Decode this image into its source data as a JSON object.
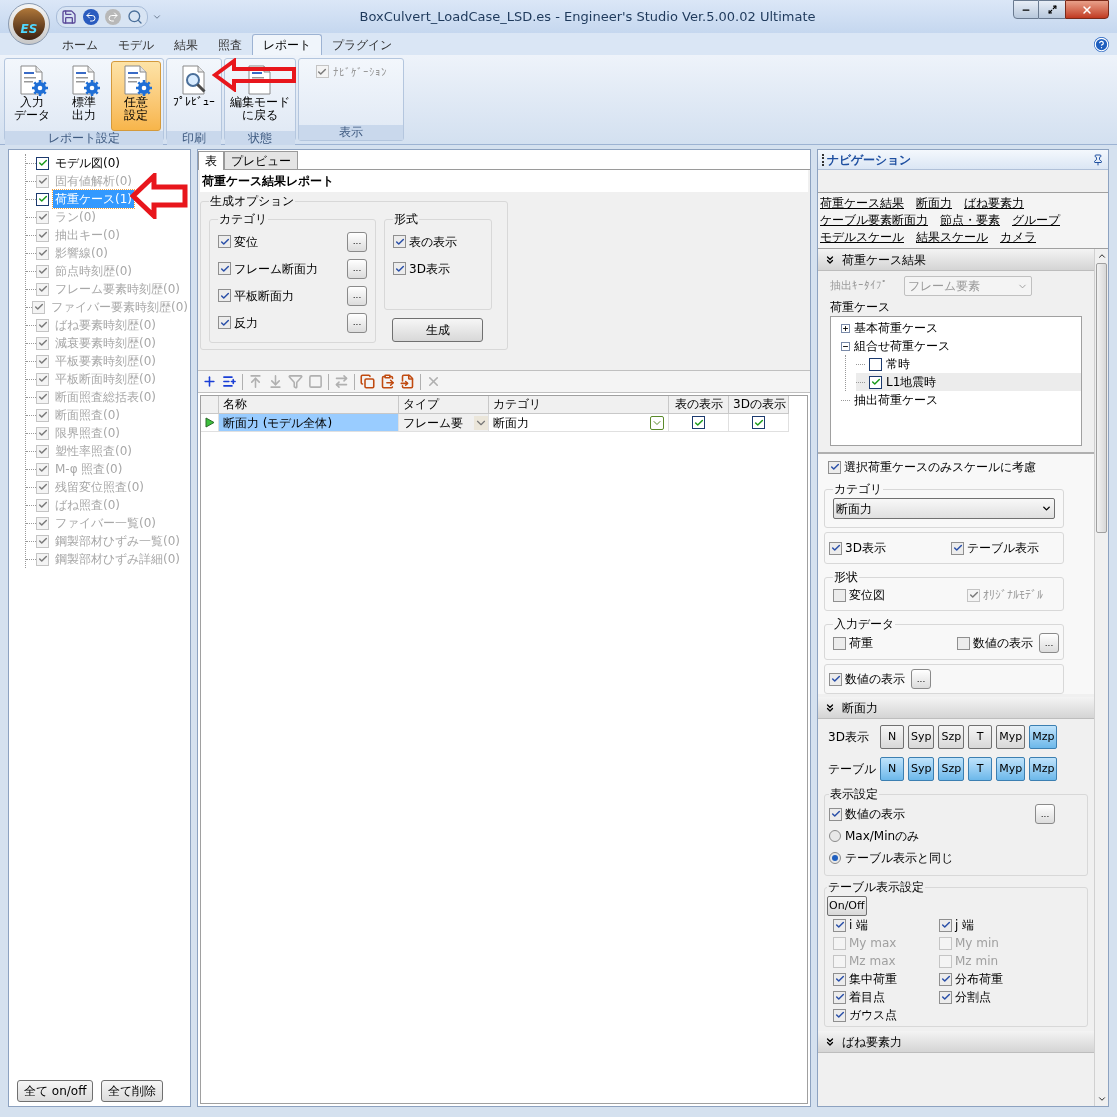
{
  "window": {
    "title": "BoxCulvert_LoadCase_LSD.es - Engineer's Studio Ver.5.00.02 Ultimate",
    "logo": "ES"
  },
  "ribbon_tabs": [
    {
      "label": "ホーム",
      "selected": false
    },
    {
      "label": "モデル",
      "selected": false
    },
    {
      "label": "結果",
      "selected": false
    },
    {
      "label": "照査",
      "selected": false
    },
    {
      "label": "レポート",
      "selected": true
    },
    {
      "label": "プラグイン",
      "selected": false
    }
  ],
  "ribbon_groups": [
    {
      "label": "レポート設定",
      "items": [
        {
          "kind": "button",
          "lines": [
            "入力",
            "データ"
          ],
          "selected": false
        },
        {
          "kind": "button",
          "lines": [
            "標準",
            "出力"
          ],
          "selected": false
        },
        {
          "kind": "button",
          "lines": [
            "任意",
            "設定"
          ],
          "selected": true
        }
      ]
    },
    {
      "label": "印刷",
      "items": [
        {
          "kind": "button",
          "lines": [
            "ﾌﾟﾚﾋﾞｭｰ"
          ],
          "selected": false
        }
      ]
    },
    {
      "label": "状態",
      "items": [
        {
          "kind": "button",
          "lines": [
            "編集モード",
            "に戻る"
          ],
          "selected": false
        }
      ]
    },
    {
      "label": "表示",
      "items": [
        {
          "kind": "checkbox",
          "label": "ﾅﾋﾞｹﾞｰｼｮﾝ",
          "checked": true,
          "disabled": true
        }
      ]
    }
  ],
  "tree": {
    "items": [
      {
        "label": "モデル図(0)",
        "checked": true,
        "disabled": false,
        "selected": false
      },
      {
        "label": "固有値解析(0)",
        "checked": true,
        "disabled": true,
        "selected": false
      },
      {
        "label": "荷重ケース(1)",
        "checked": true,
        "disabled": false,
        "selected": true
      },
      {
        "label": "ラン(0)",
        "checked": true,
        "disabled": true,
        "selected": false
      },
      {
        "label": "抽出キー(0)",
        "checked": true,
        "disabled": true,
        "selected": false
      },
      {
        "label": "影響線(0)",
        "checked": true,
        "disabled": true,
        "selected": false
      },
      {
        "label": "節点時刻歴(0)",
        "checked": true,
        "disabled": true,
        "selected": false
      },
      {
        "label": "フレーム要素時刻歴(0)",
        "checked": true,
        "disabled": true,
        "selected": false
      },
      {
        "label": "ファイバー要素時刻歴(0)",
        "checked": true,
        "disabled": true,
        "selected": false
      },
      {
        "label": "ばね要素時刻歴(0)",
        "checked": true,
        "disabled": true,
        "selected": false
      },
      {
        "label": "減衰要素時刻歴(0)",
        "checked": true,
        "disabled": true,
        "selected": false
      },
      {
        "label": "平板要素時刻歴(0)",
        "checked": true,
        "disabled": true,
        "selected": false
      },
      {
        "label": "平板断面時刻歴(0)",
        "checked": true,
        "disabled": true,
        "selected": false
      },
      {
        "label": "断面照査総括表(0)",
        "checked": true,
        "disabled": true,
        "selected": false
      },
      {
        "label": "断面照査(0)",
        "checked": true,
        "disabled": true,
        "selected": false
      },
      {
        "label": "限界照査(0)",
        "checked": true,
        "disabled": true,
        "selected": false
      },
      {
        "label": "塑性率照査(0)",
        "checked": true,
        "disabled": true,
        "selected": false
      },
      {
        "label": "M-φ 照査(0)",
        "checked": true,
        "disabled": true,
        "selected": false
      },
      {
        "label": "残留変位照査(0)",
        "checked": true,
        "disabled": true,
        "selected": false
      },
      {
        "label": "ばね照査(0)",
        "checked": true,
        "disabled": true,
        "selected": false
      },
      {
        "label": "ファイバー一覧(0)",
        "checked": true,
        "disabled": true,
        "selected": false
      },
      {
        "label": "鋼製部材ひずみ一覧(0)",
        "checked": true,
        "disabled": true,
        "selected": false
      },
      {
        "label": "鋼製部材ひずみ詳細(0)",
        "checked": true,
        "disabled": true,
        "selected": false
      }
    ],
    "buttons": [
      "全て on/off",
      "全て削除"
    ]
  },
  "center": {
    "tabs": [
      {
        "label": "表",
        "selected": true
      },
      {
        "label": "プレビュー",
        "selected": false
      }
    ],
    "title": "荷重ケース結果レポート",
    "options": {
      "legend": "生成オプション",
      "category": {
        "legend": "カテゴリ",
        "items": [
          {
            "label": "変位",
            "checked": true,
            "more": "..."
          },
          {
            "label": "フレーム断面力",
            "checked": true,
            "more": "..."
          },
          {
            "label": "平板断面力",
            "checked": true,
            "more": "..."
          },
          {
            "label": "反力",
            "checked": true,
            "more": "..."
          }
        ]
      },
      "format": {
        "legend": "形式",
        "items": [
          {
            "label": "表の表示",
            "checked": true
          },
          {
            "label": "3D表示",
            "checked": true
          }
        ]
      },
      "generate_button": "生成"
    },
    "toolbar": [
      {
        "disabled": false
      },
      {
        "disabled": false
      },
      {
        "disabled": true
      },
      {
        "disabled": true
      },
      {
        "disabled": true
      },
      {
        "disabled": true
      },
      {
        "disabled": true
      },
      {
        "disabled": false
      },
      {
        "disabled": false
      },
      {
        "disabled": false
      },
      {
        "disabled": true
      }
    ],
    "table": {
      "columns": [
        "名称",
        "タイプ",
        "カテゴリ",
        "表の表示",
        "3Dの表示"
      ],
      "rows": [
        {
          "name": "断面力 (モデル全体)",
          "type": "フレーム要",
          "category": "断面力",
          "show_table": true,
          "show_3d": true,
          "selected": true
        }
      ]
    }
  },
  "navigation": {
    "title": "ナビゲーション",
    "link_rows": [
      [
        "荷重ケース結果",
        "断面力",
        "ばね要素力"
      ],
      [
        "ケーブル要素断面力",
        "節点・要素",
        "グループ"
      ],
      [
        "モデルスケール",
        "結果スケール",
        "カメラ"
      ]
    ],
    "load_case_results": {
      "header": "荷重ケース結果",
      "key_type": {
        "label": "抽出ｷｰﾀｲﾌﾟ",
        "value": "フレーム要素",
        "disabled": true
      },
      "load_cases_label": "荷重ケース",
      "load_cases": [
        {
          "kind": "folder",
          "label": "基本荷重ケース",
          "expanded": false
        },
        {
          "kind": "folder",
          "label": "組合せ荷重ケース",
          "expanded": true,
          "children": [
            {
              "kind": "case",
              "label": "常時",
              "checked": false,
              "selected": false
            },
            {
              "kind": "case",
              "label": "L1地震時",
              "checked": true,
              "selected": true
            }
          ]
        },
        {
          "kind": "leaf",
          "label": "抽出荷重ケース"
        }
      ],
      "scale_only_selected": {
        "label": "選択荷重ケースのみスケールに考慮",
        "checked": true
      },
      "category": {
        "legend": "カテゴリ",
        "value": "断面力"
      },
      "display": [
        {
          "label": "3D表示",
          "checked": true
        },
        {
          "label": "テーブル表示",
          "checked": true
        }
      ],
      "shape": {
        "legend": "形状",
        "items": [
          {
            "label": "変位図",
            "checked": false,
            "disabled": false
          },
          {
            "label": "ｵﾘｼﾞﾅﾙﾓﾃﾞﾙ",
            "checked": true,
            "disabled": true
          }
        ]
      },
      "input_data": {
        "legend": "入力データ",
        "items": [
          {
            "label": "荷重",
            "checked": false
          },
          {
            "label": "数値の表示",
            "checked": false,
            "more": "..."
          }
        ]
      },
      "values": {
        "label": "数値の表示",
        "checked": true,
        "more": "..."
      }
    },
    "section_forces": {
      "header": "断面力",
      "toggle_rows": [
        {
          "label": "3D表示",
          "toggles": [
            {
              "label": "N",
              "on": false
            },
            {
              "label": "Syp",
              "on": false
            },
            {
              "label": "Szp",
              "on": false
            },
            {
              "label": "T",
              "on": false
            },
            {
              "label": "Myp",
              "on": false
            },
            {
              "label": "Mzp",
              "on": true
            }
          ]
        },
        {
          "label": "テーブル",
          "toggles": [
            {
              "label": "N",
              "on": true
            },
            {
              "label": "Syp",
              "on": true
            },
            {
              "label": "Szp",
              "on": true
            },
            {
              "label": "T",
              "on": true
            },
            {
              "label": "Myp",
              "on": true
            },
            {
              "label": "Mzp",
              "on": true
            }
          ]
        }
      ],
      "display_settings": {
        "legend": "表示設定",
        "values": {
          "label": "数値の表示",
          "checked": true,
          "more": "..."
        },
        "radios": [
          {
            "label": "Max/Minのみ",
            "selected": false
          },
          {
            "label": "テーブル表示と同じ",
            "selected": true
          }
        ]
      },
      "table_settings": {
        "legend": "テーブル表示設定",
        "toggle_button": "On/Off",
        "items": [
          {
            "label": "i 端",
            "checked": true,
            "disabled": false
          },
          {
            "label": "j 端",
            "checked": true,
            "disabled": false
          },
          {
            "label": "My max",
            "checked": false,
            "disabled": true
          },
          {
            "label": "My min",
            "checked": false,
            "disabled": true
          },
          {
            "label": "Mz max",
            "checked": false,
            "disabled": true
          },
          {
            "label": "Mz min",
            "checked": false,
            "disabled": true
          },
          {
            "label": "集中荷重",
            "checked": true,
            "disabled": false
          },
          {
            "label": "分布荷重",
            "checked": true,
            "disabled": false
          },
          {
            "label": "着目点",
            "checked": true,
            "disabled": false
          },
          {
            "label": "分割点",
            "checked": true,
            "disabled": false
          },
          {
            "label": "ガウス点",
            "checked": true,
            "disabled": false
          }
        ]
      }
    },
    "spring_forces": {
      "header": "ばね要素力"
    }
  }
}
